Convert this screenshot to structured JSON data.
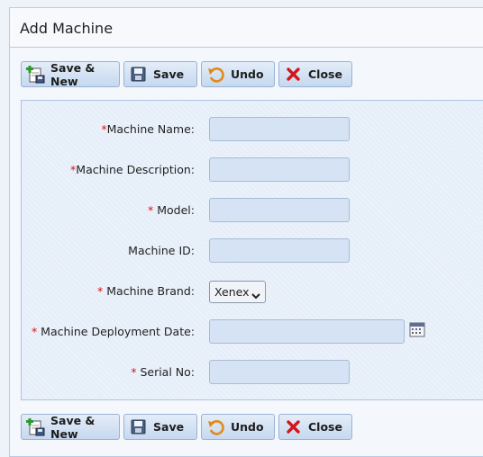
{
  "window": {
    "title": "Add Machine"
  },
  "toolbar": {
    "save_new": "Save & New",
    "save": "Save",
    "undo": "Undo",
    "close": "Close"
  },
  "form": {
    "machine_name_label": "Machine Name:",
    "machine_description_label": "Machine Description:",
    "model_label": "Model:",
    "machine_id_label": "Machine ID:",
    "machine_brand_label": "Machine Brand:",
    "machine_brand_value": "Xenex",
    "machine_deployment_date_label": "Machine Deployment Date:",
    "serial_no_label": "Serial No:",
    "required_marker": "*"
  },
  "icons": {
    "save_new": "save-new-icon",
    "save": "floppy-disk-icon",
    "undo": "undo-icon",
    "close": "close-x-icon",
    "calendar": "calendar-icon"
  },
  "colors": {
    "required": "#dd1111",
    "button_gradient_top": "#e4edf9",
    "button_gradient_bottom": "#c6d8ef",
    "input_background": "#d6e3f4"
  }
}
